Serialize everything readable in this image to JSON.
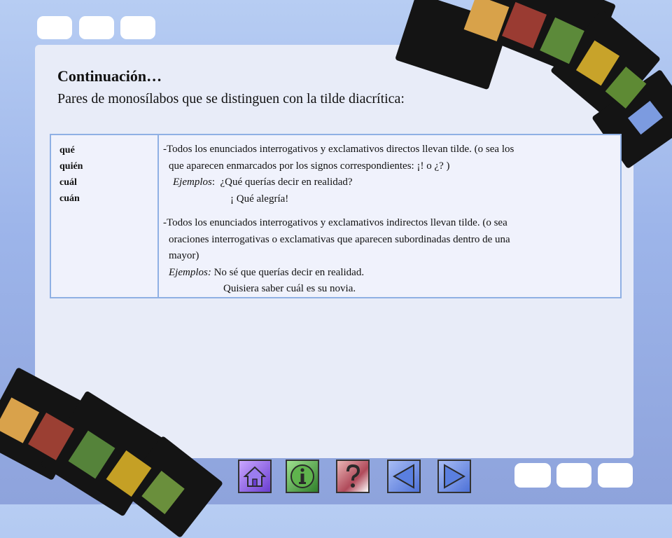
{
  "slide": {
    "title": "Continuación…",
    "subtitle": "Pares de monosílabos que se distinguen con la tilde diacrítica:"
  },
  "table": {
    "words": [
      "qué",
      "quién",
      "cuál",
      "cuán"
    ],
    "rule1": {
      "line1": "-Todos los enunciados interrogativos y exclamativos directos llevan tilde. (o sea los",
      "line2": "que aparecen enmarcados por los signos correspondientes: ¡! o ¿? )",
      "examples_label": "Ejemplos",
      "example1": "¿Qué querías decir en realidad?",
      "example2": "¡ Qué alegría!"
    },
    "rule2": {
      "line1": "-Todos los enunciados interrogativos y exclamativos indirectos llevan tilde. (o sea",
      "line2": "oraciones interrogativas o exclamativas que aparecen subordinadas dentro de una",
      "line3": "mayor)",
      "examples_label": "Ejemplos:",
      "example1": "No sé que querías decir en realidad.",
      "example2": "Quisiera saber cuál es su novia."
    }
  },
  "nav": {
    "buttons": [
      "home-icon",
      "info-icon",
      "help-icon",
      "back-arrow-icon",
      "forward-arrow-icon"
    ]
  },
  "colors": {
    "background": "#9db5ea",
    "panel": "#e8ecf8",
    "table_border": "#8fb0e4",
    "home_button": "#7a4fd6",
    "info_button": "#3f9a3a",
    "help_button": "#b85060",
    "arrow_button": "#4e72d8"
  }
}
